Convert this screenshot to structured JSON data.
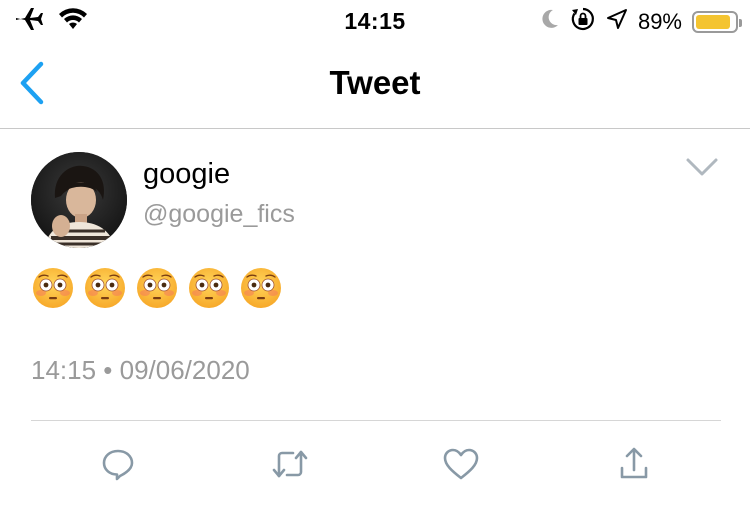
{
  "status_bar": {
    "time": "14:15",
    "battery_percent": "89%",
    "battery_level": 0.89,
    "icons": [
      "airplane-icon",
      "wifi-icon",
      "moon-icon",
      "orientation-lock-icon",
      "location-icon",
      "battery-icon"
    ]
  },
  "nav": {
    "title": "Tweet",
    "back_icon": "chevron-left-icon"
  },
  "tweet": {
    "display_name": "googie",
    "handle": "@googie_fics",
    "body_emojis": [
      "flushed-face",
      "flushed-face",
      "flushed-face",
      "flushed-face",
      "flushed-face"
    ],
    "timestamp": "14:15 • 09/06/2020"
  },
  "actions": [
    "reply-icon",
    "retweet-icon",
    "like-icon",
    "share-icon"
  ],
  "colors": {
    "accent": "#1da1f2",
    "secondary_text": "#9a9a9a",
    "icon_gray": "#8899a6",
    "battery": "#f4c430"
  }
}
